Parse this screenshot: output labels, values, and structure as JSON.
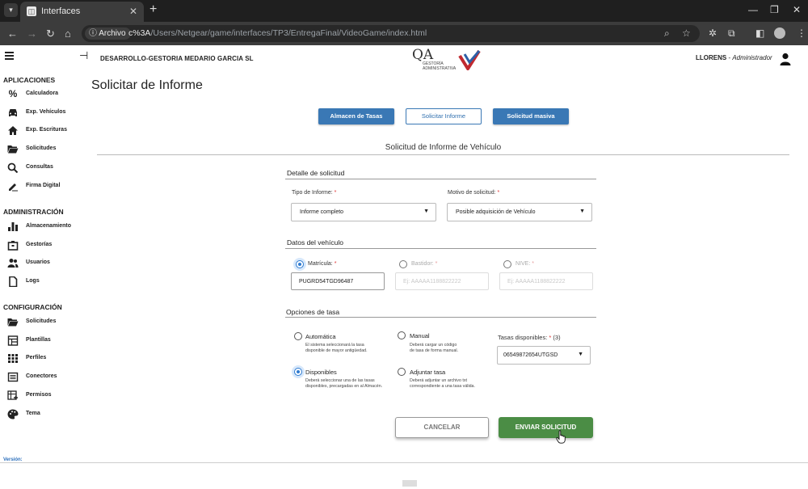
{
  "browser": {
    "tab_title": "Interfaces",
    "chip_label": "Archivo",
    "url_prefix": "c%3A",
    "url_path": "/Users/Netgear/game/interfaces/TP3/EntregaFinal/VideoGame/index.html"
  },
  "header": {
    "company": "DESARROLLO-GESTORIA MEDARIO GARCIA SL",
    "logo_text": "QA",
    "logo_sub_1": "GESTORÍA",
    "logo_sub_2": "ADMINISTRATIVA",
    "user_name": "LLORENS",
    "user_sep": " - ",
    "user_role": "Administrador"
  },
  "sidebar": {
    "sections": [
      {
        "title": "APLICACIONES",
        "items": [
          {
            "label": "Calculadora",
            "icon": "percent-icon"
          },
          {
            "label": "Exp. Vehículos",
            "icon": "car-icon"
          },
          {
            "label": "Exp. Escrituras",
            "icon": "home-icon"
          },
          {
            "label": "Solicitudes",
            "icon": "folder-open-icon"
          },
          {
            "label": "Consultas",
            "icon": "search-icon"
          },
          {
            "label": "Firma Digital",
            "icon": "signature-icon"
          }
        ]
      },
      {
        "title": "ADMINISTRACIÓN",
        "items": [
          {
            "label": "Almacenamiento",
            "icon": "bar-chart-icon"
          },
          {
            "label": "Gestorías",
            "icon": "office-icon"
          },
          {
            "label": "Usuarios",
            "icon": "users-icon"
          },
          {
            "label": "Logs",
            "icon": "document-icon"
          }
        ]
      },
      {
        "title": "CONFIGURACIÓN",
        "items": [
          {
            "label": "Solicitudes",
            "icon": "folder-open-icon"
          },
          {
            "label": "Plantillas",
            "icon": "template-icon"
          },
          {
            "label": "Perfiles",
            "icon": "grid-icon"
          },
          {
            "label": "Conectores",
            "icon": "list-icon"
          },
          {
            "label": "Permisos",
            "icon": "permissions-icon"
          },
          {
            "label": "Tema",
            "icon": "palette-icon"
          }
        ]
      }
    ],
    "version_label": "Versión:"
  },
  "main": {
    "page_title": "Solicitar de Informe",
    "top_buttons": {
      "almacen": "Almacen de Tasas",
      "solicitar": "Solicitar Informe",
      "masiva": "Solicitud masiva"
    },
    "form_heading": "Solicitud de Informe de Vehículo",
    "detalle": {
      "title": "Detalle de solicitud",
      "tipo_label": "Tipo de Informe:",
      "tipo_value": "Informe completo",
      "motivo_label": "Motivo de solicitud:",
      "motivo_value": "Posible adquisición de Vehículo"
    },
    "vehiculo": {
      "title": "Datos del vehículo",
      "matricula_label": "Matrícula:",
      "matricula_value": "PUGRD54TGD96487",
      "bastidor_label": "Bastidor:",
      "bastidor_placeholder": "Ej: AAAAA1188822222",
      "nive_label": "NIVE:",
      "nive_placeholder": "Ej: AAAAA1188822222",
      "selected": "matricula"
    },
    "tasa": {
      "title": "Opciones de tasa",
      "automatica": {
        "title": "Automática",
        "desc": "El sistema seleccionará la tasa\ndisponible de mayor antigüedad."
      },
      "manual": {
        "title": "Manual",
        "desc": "Deberá cargar un código\nde tasa de forma manual."
      },
      "disponibles": {
        "title": "Disponibles",
        "desc": "Deberá seleccionar una de las tasas\ndisponibles, precargadas en al Almacén."
      },
      "adjuntar": {
        "title": "Adjuntar tasa",
        "desc": "Deberá adjuntar un archivo txt\ncorrespondiente a una tasa válida."
      },
      "selected": "disponibles",
      "tasas_label": "Tasas disponibles:",
      "tasas_count": "(3)",
      "tasas_value": "06549872654UTGSD"
    },
    "actions": {
      "cancel": "CANCELAR",
      "send": "ENVIAR SOLICITUD"
    }
  },
  "colors": {
    "primary_blue": "#3a78b5",
    "send_green": "#4b8d45",
    "radio_blue": "#2f7bd0",
    "required_red": "#d33333"
  }
}
